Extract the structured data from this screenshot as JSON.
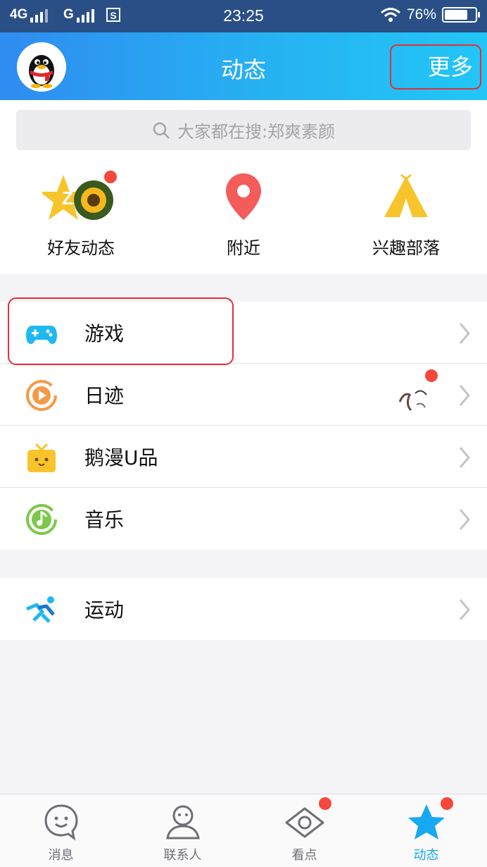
{
  "status_bar": {
    "network_1": "4G",
    "network_2": "G",
    "sim_icon": "sim-card-icon",
    "time": "23:25",
    "battery_text": "76%",
    "battery_level": 0.76
  },
  "header": {
    "title": "动态",
    "more_label": "更多",
    "avatar": "qq-penguin-avatar"
  },
  "search": {
    "placeholder": "大家都在搜:郑爽素颜"
  },
  "shortcuts": [
    {
      "label": "好友动态",
      "icon": "qzone-star-icon",
      "badge": true
    },
    {
      "label": "附近",
      "icon": "location-pin-icon",
      "badge": false
    },
    {
      "label": "兴趣部落",
      "icon": "tent-icon",
      "badge": false
    }
  ],
  "list_1": [
    {
      "label": "游戏",
      "icon": "gamepad-icon"
    },
    {
      "label": "日迹",
      "icon": "play-circle-icon",
      "badge": true
    },
    {
      "label": "鹅漫U品",
      "icon": "gift-box-icon"
    },
    {
      "label": "音乐",
      "icon": "music-note-icon"
    }
  ],
  "list_2": [
    {
      "label": "运动",
      "icon": "running-icon"
    }
  ],
  "tabs": [
    {
      "label": "消息",
      "icon": "chat-bubble-icon",
      "badge": false
    },
    {
      "label": "联系人",
      "icon": "contact-icon",
      "badge": false
    },
    {
      "label": "看点",
      "icon": "eye-icon",
      "badge": true
    },
    {
      "label": "动态",
      "icon": "star-icon",
      "badge": true,
      "active": true
    }
  ],
  "colors": {
    "accent": "#16a8f0",
    "highlight_border": "#e0313a",
    "badge": "#f6483b"
  }
}
